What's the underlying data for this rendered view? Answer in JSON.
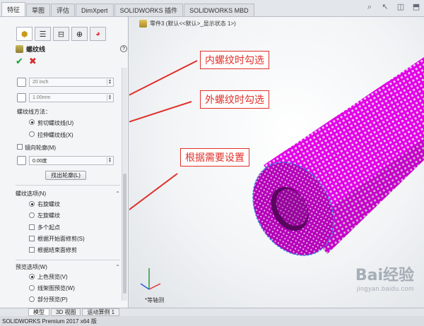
{
  "tabs": [
    "特征",
    "草图",
    "评估",
    "DimXpert",
    "SOLIDWORKS 插件",
    "SOLIDWORKS MBD"
  ],
  "panel_tabs": [
    "feature-manager-icon",
    "property-manager-icon",
    "config-manager-icon",
    "dimxpert-icon",
    "display-manager-icon"
  ],
  "feature": {
    "title": "螺纹线",
    "help": "?"
  },
  "fields": {
    "size": "20 inch",
    "pitch": "1.00mm",
    "angle": "0.00度"
  },
  "thread_method": {
    "label": "螺纹线方法：",
    "options": [
      "剪切螺纹线(U)",
      "拉伸螺纹线(X)"
    ],
    "selected": 0
  },
  "mirror_profile": "镜向轮廓(M)",
  "find_profile_button": "找出轮廓(L)",
  "thread_options": {
    "label": "螺纹选项(N)",
    "options": [
      "右旋螺纹",
      "左旋螺纹"
    ],
    "selected": 0,
    "checks": [
      "多个起点",
      "根据开始面修剪(S)",
      "根据结束面修剪"
    ]
  },
  "preview_options": {
    "label": "预览选项(W)",
    "options": [
      "上色预览(V)",
      "线架图预览(W)",
      "部分预览(P)"
    ],
    "selected": 0
  },
  "breadcrumb": "零件3 (默认<<默认>_显示状态 1>)",
  "callouts": [
    "内螺纹时勾选",
    "外螺纹时勾选",
    "根据需要设置"
  ],
  "view_label": "*等轴测",
  "bottom_tabs": [
    "模型",
    "3D 视图",
    "运动算例 1"
  ],
  "status_text": "SOLIDWORKS Premium 2017 x64 版",
  "watermark": {
    "main": "Bai经验",
    "sub": "jingyan.baidu.com"
  },
  "colors": {
    "accent": "#e0302a",
    "tube": "#e200e6",
    "ok": "#1a9b2c"
  }
}
